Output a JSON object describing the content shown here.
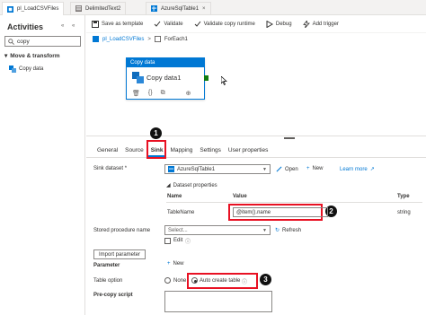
{
  "tabs": [
    {
      "label": "pl_LoadCSVFiles",
      "active": true
    },
    {
      "label": "DelimitedText2",
      "active": false
    },
    {
      "label": "AzureSqlTable1",
      "active": false
    }
  ],
  "left_panel": {
    "title": "Activities",
    "collapse_left": "«",
    "collapse_up": "«",
    "search_value": "copy",
    "group": "Move & transform",
    "item": "Copy data"
  },
  "toolbar": {
    "save_template": "Save as template",
    "validate": "Validate",
    "validate_copy": "Validate copy runtime",
    "debug": "Debug",
    "add_trigger": "Add trigger"
  },
  "breadcrumb": {
    "pipeline": "pl_LoadCSVFiles",
    "separator": ">",
    "current": "ForEach1"
  },
  "activity": {
    "type": "Copy data",
    "name": "Copy data1"
  },
  "property_tabs": [
    "General",
    "Source",
    "Sink",
    "Mapping",
    "Settings",
    "User properties"
  ],
  "badges": {
    "one": "1",
    "two": "2",
    "three": "3"
  },
  "sink": {
    "dataset_label": "Sink dataset *",
    "dataset_value": "AzureSqlTable1",
    "open": "Open",
    "new": "New",
    "learn_more": "Learn more",
    "dataset_properties": "Dataset properties",
    "col_name": "Name",
    "col_value": "Value",
    "col_type": "Type",
    "row_name": "TableName",
    "row_value": "@item().name",
    "row_type": "string",
    "sp_label": "Stored procedure name",
    "sp_placeholder": "Select...",
    "refresh": "Refresh",
    "edit": "Edit",
    "import_parameter": "Import parameter",
    "parameter_label": "Parameter",
    "parameter_new": "New",
    "table_option_label": "Table option",
    "option_none": "None",
    "option_auto": "Auto create table",
    "precopy_label": "Pre-copy script"
  }
}
